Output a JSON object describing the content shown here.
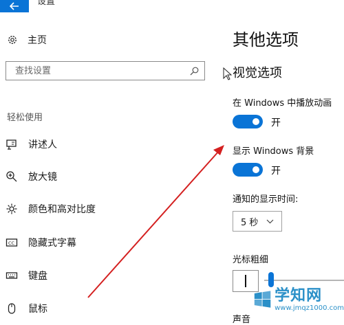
{
  "window": {
    "title": "设置"
  },
  "nav": {
    "home_label": "主页",
    "search_placeholder": "查找设置",
    "section_title": "轻松使用",
    "items": [
      {
        "label": "讲述人",
        "icon": "narrator-icon"
      },
      {
        "label": "放大镜",
        "icon": "magnifier-icon"
      },
      {
        "label": "颜色和高对比度",
        "icon": "brightness-icon"
      },
      {
        "label": "隐藏式字幕",
        "icon": "closed-captions-icon"
      },
      {
        "label": "键盘",
        "icon": "keyboard-icon"
      },
      {
        "label": "鼠标",
        "icon": "mouse-icon"
      }
    ]
  },
  "content": {
    "title": "其他选项",
    "visual_section": "视觉选项",
    "animation_label": "在 Windows 中播放动画",
    "animation_state": "开",
    "background_label": "显示 Windows 背景",
    "background_state": "开",
    "notification_label": "通知的显示时间:",
    "notification_value": "5 秒",
    "cursor_label": "光标粗细",
    "cursor_thickness_fraction": 0.05,
    "next_label": "声音"
  },
  "watermark": {
    "title": "学知网",
    "url": "www.jmqz1000.com"
  },
  "colors": {
    "accent": "#0a74d6",
    "annotation_arrow": "#d42020",
    "watermark": "#2b90c8"
  }
}
